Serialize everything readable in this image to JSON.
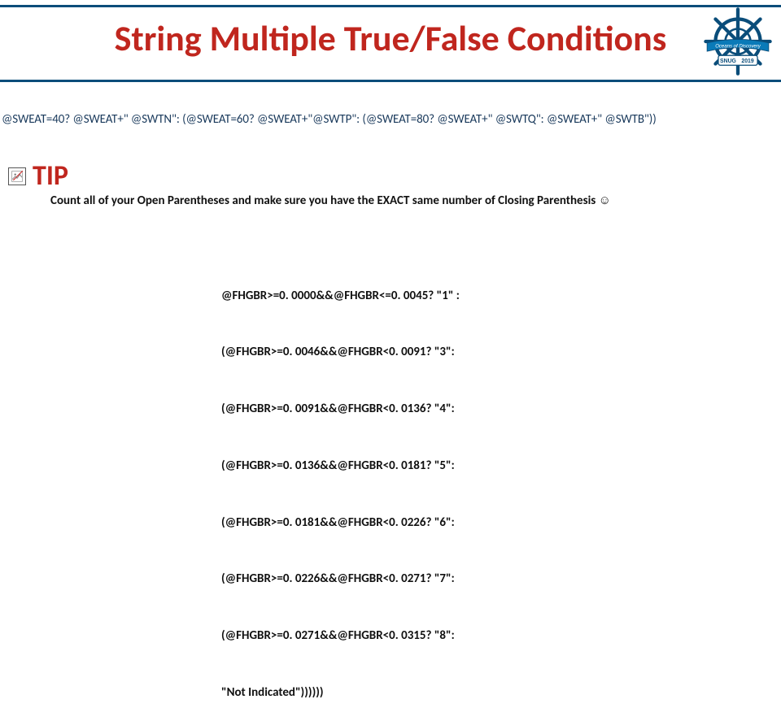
{
  "title": "String Multiple True/False Conditions",
  "logo": {
    "banner_text": "Oceans of Discovery",
    "badge_left": "SNUG",
    "badge_right": "2019"
  },
  "long_code": "@SWEAT=40? @SWEAT+\" @SWTN\": (@SWEAT=60? @SWEAT+\"@SWTP\": (@SWEAT=80? @SWEAT+\" @SWTQ\": @SWEAT+\" @SWTB\"))",
  "tip": {
    "label": "TIP",
    "text": "Count all of your Open Parentheses and make sure you have the EXACT same number of Closing Parenthesis ",
    "emoji": "☺"
  },
  "code_block": {
    "lines": [
      "@FHGBR>=0. 0000&&@FHGBR<=0. 0045? \"1\" :",
      "(@FHGBR>=0. 0046&&@FHGBR<0. 0091? \"3\":",
      "(@FHGBR>=0. 0091&&@FHGBR<0. 0136? \"4\":",
      "(@FHGBR>=0. 0136&&@FHGBR<0. 0181? \"5\":",
      "(@FHGBR>=0. 0181&&@FHGBR<0. 0226? \"6\":",
      "(@FHGBR>=0. 0226&&@FHGBR<0. 0271? \"7\":",
      "(@FHGBR>=0. 0271&&@FHGBR<0. 0315? \"8\":",
      "\"Not Indicated\"))))))"
    ]
  }
}
